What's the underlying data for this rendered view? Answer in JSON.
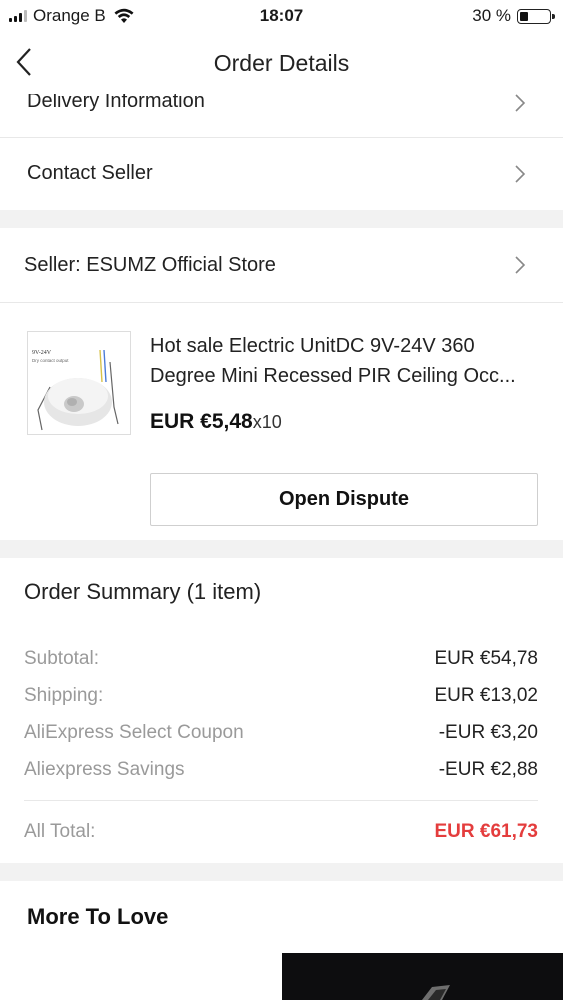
{
  "status_bar": {
    "carrier": "Orange B",
    "time": "18:07",
    "battery": "30 %"
  },
  "header": {
    "title": "Order Details"
  },
  "rows": {
    "delivery_info": "Delivery Information",
    "contact_seller": "Contact Seller",
    "seller": "Seller: ESUMZ Official Store"
  },
  "product": {
    "title_line1": "Hot sale Electric UnitDC 9V-24V 360",
    "title_line2": "Degree Mini Recessed PIR Ceiling Occ...",
    "price": "EUR €5,48",
    "quantity": "x10",
    "image_caption_1": "9V-24V",
    "image_caption_2": "Dry contact output",
    "open_dispute_label": "Open Dispute"
  },
  "summary": {
    "title": "Order Summary (1 item)",
    "lines": [
      {
        "label": "Subtotal:",
        "value": "EUR €54,78"
      },
      {
        "label": "Shipping:",
        "value": "EUR €13,02"
      },
      {
        "label": "AliExpress Select Coupon",
        "value": "-EUR €3,20"
      },
      {
        "label": "Aliexpress Savings",
        "value": "-EUR €2,88"
      }
    ],
    "total_label": "All Total:",
    "total_value": "EUR €61,73",
    "total_color": "#e43d3d"
  },
  "more_to_love": {
    "title": "More To Love"
  }
}
